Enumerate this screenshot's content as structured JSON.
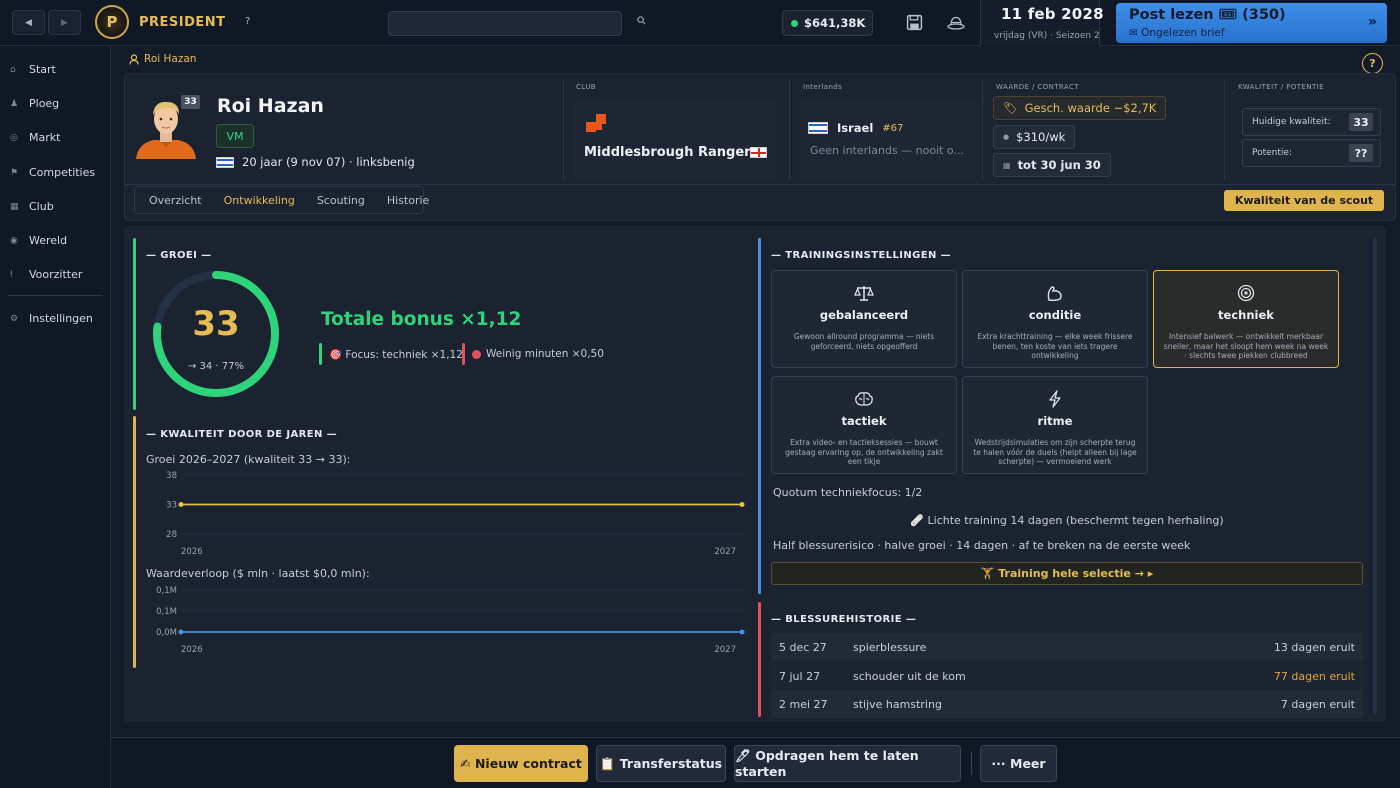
{
  "topbar": {
    "back_icon": "◀",
    "forward_icon": "▶",
    "logo_letter": "P",
    "brand": "PRESIDENT",
    "help": "?",
    "search_placeholder": "",
    "money": "$641,38K",
    "date": "11 feb 2028",
    "day": "vrijdag (VR) · Seizoen 2",
    "post_title": "Post lezen 🎟 (350)",
    "post_sub": "✉ Ongelezen brief",
    "post_arrow": "»"
  },
  "sidebar": {
    "items": [
      {
        "label": "Start",
        "icon": "home-icon"
      },
      {
        "label": "Ploeg",
        "icon": "squad-icon"
      },
      {
        "label": "Markt",
        "icon": "market-icon"
      },
      {
        "label": "Competities",
        "icon": "competition-icon"
      },
      {
        "label": "Club",
        "icon": "club-icon"
      },
      {
        "label": "Wereld",
        "icon": "globe-icon"
      },
      {
        "label": "Voorzitter",
        "icon": "chairman-icon"
      },
      {
        "label": "Instellingen",
        "icon": "settings-icon"
      }
    ]
  },
  "breadcrumb": "Roi Hazan",
  "help": "?",
  "player": {
    "name": "Roi Hazan",
    "age_badge": "33",
    "position": "VM",
    "info": "20 jaar (9 nov 07) · linksbenig",
    "club_label": "CLUB",
    "club": "Middlesbrough Rangers",
    "intl_label": "Interlands",
    "country": "Israel",
    "rank": "#67",
    "intl_text": "Geen interlands — nooit o...",
    "value_label": "WAARDE / CONTRACT",
    "est_value": "Gesch. waarde ~$2,7K",
    "wage": "$310/wk",
    "contract": "tot 30 jun 30",
    "quality_label": "KWALITEIT / POTENTIE",
    "current_quality_label": "Huidige kwaliteit:",
    "current_quality": "33",
    "potential_label": "Potentie:",
    "potential": "??"
  },
  "tabs": [
    "Overzicht",
    "Ontwikkeling",
    "Scouting",
    "Historie"
  ],
  "active_tab": "Ontwikkeling",
  "scout_button": "Kwaliteit van de scout",
  "growth": {
    "title": "— GROEI —",
    "value": "33",
    "sub": "→ 34 · 77%",
    "progress": 0.77,
    "bonus": "Totale bonus ×1,12",
    "focus": "🎯 Focus: techniek ×1,12",
    "minutes": "Weinig minuten ×0,50"
  },
  "quality_years": {
    "title": "— KWALITEIT DOOR DE JAREN —",
    "subtitle": "Groei 2026–2027 (kwaliteit 33 → 33):",
    "value_subtitle": "Waardeverloop ($ mln · laatst $0,0 mln):"
  },
  "chart_data": [
    {
      "type": "line",
      "title": "Groei 2026–2027 (kwaliteit 33 → 33):",
      "x": [
        "2026",
        "2027"
      ],
      "series": [
        {
          "values": [
            33,
            33
          ]
        }
      ],
      "yticks": [
        "38",
        "33",
        "28"
      ],
      "ylim": [
        28,
        38
      ],
      "color": "#e0c24a"
    },
    {
      "type": "line",
      "title": "Waardeverloop ($ mln · laatst $0,0 mln):",
      "x": [
        "2026",
        "2027"
      ],
      "series": [
        {
          "values": [
            0,
            0
          ]
        }
      ],
      "yticks": [
        "0,1M",
        "0,1M",
        "0,0M"
      ],
      "ylim": [
        0,
        0.1
      ],
      "color": "#4a8fe0"
    }
  ],
  "training": {
    "title": "— TRAININGSINSTELLINGEN —",
    "cards": [
      {
        "name": "gebalanceerd",
        "icon": "scale-icon",
        "desc": "Gewoon allround programma — niets geforceerd, niets opgeofferd"
      },
      {
        "name": "conditie",
        "icon": "muscle-icon",
        "desc": "Extra krachttraining — elke week frissere benen, ten koste van iets tragere ontwikkeling"
      },
      {
        "name": "techniek",
        "icon": "target-icon",
        "desc": "Intensief balwerk — ontwikkelt merkbaar sneller, maar het sloopt hem week na week · slechts twee plekken clubbreed"
      },
      {
        "name": "tactiek",
        "icon": "brain-icon",
        "desc": "Extra video- en tactieksessies — bouwt gestaag ervaring op, de ontwikkeling zakt een tikje"
      },
      {
        "name": "ritme",
        "icon": "bolt-icon",
        "desc": "Wedstrijdsimulaties om zijn scherpte terug te halen vóór de duels (helpt alleen bij lage scherpte) — vermoeiend werk"
      }
    ],
    "selected": "techniek",
    "quota": "Quotum techniekfocus: 1/2",
    "light": "🩹 Lichte training 14 dagen (beschermt tegen herhaling)",
    "risk": "Half blessurerisico · halve groei · 14 dagen · af te breken na de eerste week",
    "team_button": "🏋 Training hele selectie → ▸"
  },
  "injuries": {
    "title": "— BLESSUREHISTORIE —",
    "rows": [
      {
        "date": "5 dec 27",
        "type": "spierblessure",
        "days": "13 dagen eruit",
        "highlight": false
      },
      {
        "date": "7 jul 27",
        "type": "schouder uit de kom",
        "days": "77 dagen eruit",
        "highlight": true
      },
      {
        "date": "2 mei 27",
        "type": "stijve hamstring",
        "days": "7 dagen eruit",
        "highlight": false
      }
    ]
  },
  "bottom": {
    "new_contract": "✍ Nieuw contract",
    "transfer": "📋 Transferstatus",
    "start": "🖊 Opdragen hem te laten starten",
    "more": "··· Meer"
  },
  "colors": {
    "gold": "#e0b44d",
    "green": "#2ed47a",
    "blue": "#4a8fe0",
    "red": "#e0525a",
    "orange_text": "#e6a43a"
  }
}
